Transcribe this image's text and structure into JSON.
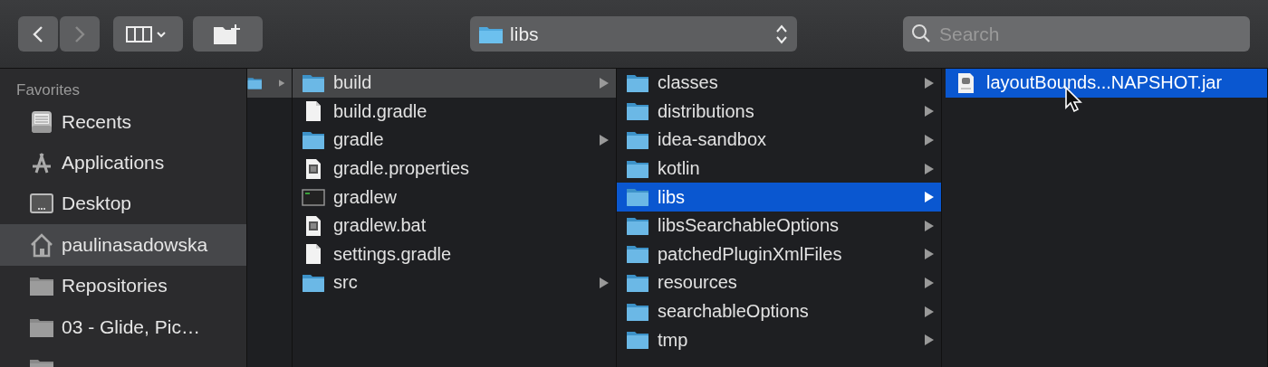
{
  "toolbar": {
    "location": {
      "label": "libs"
    },
    "search": {
      "placeholder": "Search"
    }
  },
  "sidebar": {
    "section": "Favorites",
    "items": [
      {
        "name": "Recents",
        "kind": "recents",
        "selected": false
      },
      {
        "name": "Applications",
        "kind": "applications",
        "selected": false
      },
      {
        "name": "Desktop",
        "kind": "desktop",
        "selected": false
      },
      {
        "name": "paulinasadowska",
        "kind": "home",
        "selected": true
      },
      {
        "name": "Repositories",
        "kind": "folder",
        "selected": false
      },
      {
        "name": "03 - Glide, Pic…",
        "kind": "folder",
        "selected": false
      },
      {
        "kind": "folder",
        "selected": false
      }
    ]
  },
  "columns": [
    {
      "focused": false,
      "items": [
        {
          "kind": "folder",
          "selected": true,
          "expandable": true
        }
      ]
    },
    {
      "focused": false,
      "items": [
        {
          "name": "build",
          "kind": "folder",
          "selected": true,
          "expandable": true
        },
        {
          "name": "build.gradle",
          "kind": "document",
          "selected": false,
          "expandable": false
        },
        {
          "name": "gradle",
          "kind": "folder",
          "selected": false,
          "expandable": true
        },
        {
          "name": "gradle.properties",
          "kind": "properties",
          "selected": false,
          "expandable": false
        },
        {
          "name": "gradlew",
          "kind": "terminal",
          "selected": false,
          "expandable": false
        },
        {
          "name": "gradlew.bat",
          "kind": "properties",
          "selected": false,
          "expandable": false
        },
        {
          "name": "settings.gradle",
          "kind": "document",
          "selected": false,
          "expandable": false
        },
        {
          "name": "src",
          "kind": "folder",
          "selected": false,
          "expandable": true
        }
      ]
    },
    {
      "focused": true,
      "items": [
        {
          "name": "classes",
          "kind": "folder",
          "selected": false,
          "expandable": true
        },
        {
          "name": "distributions",
          "kind": "folder",
          "selected": false,
          "expandable": true
        },
        {
          "name": "idea-sandbox",
          "kind": "folder",
          "selected": false,
          "expandable": true
        },
        {
          "name": "kotlin",
          "kind": "folder",
          "selected": false,
          "expandable": true
        },
        {
          "name": "libs",
          "kind": "folder",
          "selected": true,
          "expandable": true
        },
        {
          "name": "libsSearchableOptions",
          "kind": "folder",
          "selected": false,
          "expandable": true
        },
        {
          "name": "patchedPluginXmlFiles",
          "kind": "folder",
          "selected": false,
          "expandable": true
        },
        {
          "name": "resources",
          "kind": "folder",
          "selected": false,
          "expandable": true
        },
        {
          "name": "searchableOptions",
          "kind": "folder",
          "selected": false,
          "expandable": true
        },
        {
          "name": "tmp",
          "kind": "folder",
          "selected": false,
          "expandable": true
        }
      ]
    },
    {
      "focused": true,
      "items": [
        {
          "name": "layoutBounds...NAPSHOT.jar",
          "kind": "jar",
          "selected": true,
          "expandable": false
        }
      ]
    }
  ]
}
